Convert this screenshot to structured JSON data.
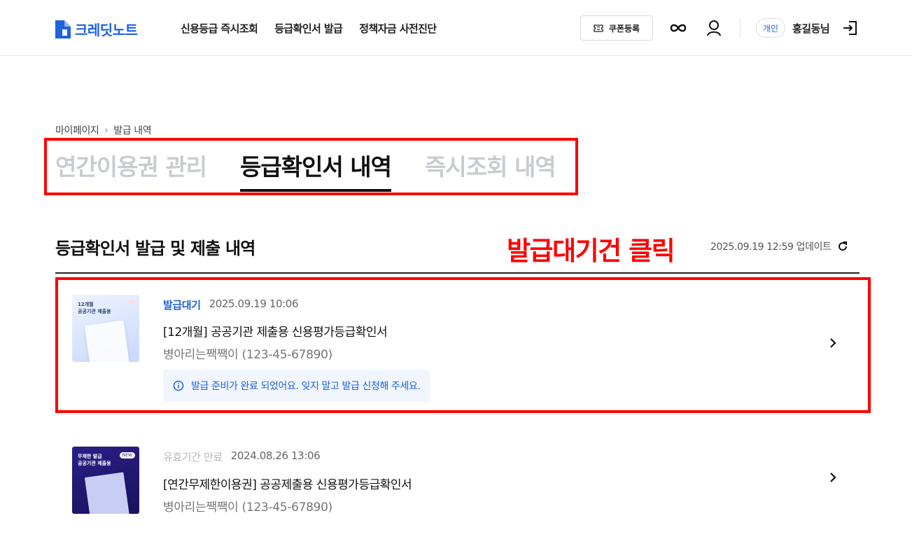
{
  "header": {
    "logo_text": "크레딧노트",
    "nav": [
      "신용등급 즉시조회",
      "등급확인서 발급",
      "정책자금 사전진단"
    ],
    "coupon_label": "쿠폰등록",
    "account_type": "개인",
    "user_name": "홍길동님"
  },
  "breadcrumb": {
    "root": "마이페이지",
    "separator": "›",
    "current": "발급 내역"
  },
  "tabs": [
    {
      "label": "연간이용권 관리",
      "active": false
    },
    {
      "label": "등급확인서 내역",
      "active": true
    },
    {
      "label": "즉시조회 내역",
      "active": false
    }
  ],
  "annotation": {
    "text": "발급대기건 클릭",
    "color": "#ff0000"
  },
  "section": {
    "title": "등급확인서 발급 및 제출 내역",
    "update_text": "2025.09.19 12:59 업데이트"
  },
  "items": [
    {
      "thumb_label_1": "12개월",
      "thumb_label_2": "공공기관 제출용",
      "status": "발급대기",
      "date": "2025.09.19 10:06",
      "title": "[12개월] 공공기관 제출용 신용평가등급확인서",
      "company": "병아리는짹짹이 (123-45-67890)",
      "notice": "발급 준비가 완료 되었어요. 잊지 말고 발급 신청해 주세요."
    },
    {
      "thumb_label_1": "무제한 발급",
      "thumb_label_2": "공공기관 제출용",
      "thumb_tag": "NEW",
      "status": "유효기간 만료",
      "date": "2024.08.26 13:06",
      "title": "[연간무제한이용권] 공공제출용 신용평가등급확인서",
      "company": "병아리는짹짹이 (123-45-67890)"
    }
  ],
  "colors": {
    "brand": "#1c63e0",
    "annotation": "#ff0000",
    "notice_bg": "#f1f6fe"
  }
}
